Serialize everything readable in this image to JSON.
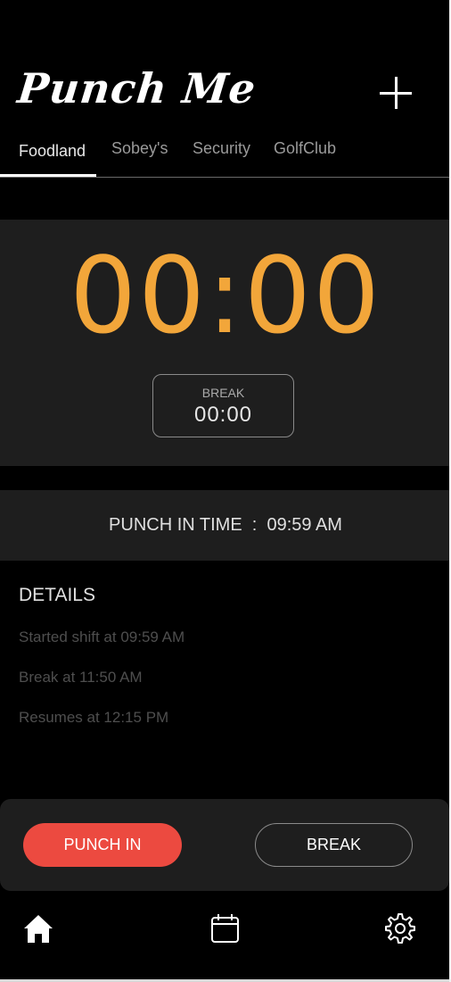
{
  "header": {
    "title": "Punch Me",
    "add_icon": "plus-icon"
  },
  "tabs": [
    {
      "label": "Foodland",
      "active": true
    },
    {
      "label": "Sobey's",
      "active": false
    },
    {
      "label": "Security",
      "active": false
    },
    {
      "label": "GolfClub",
      "active": false
    }
  ],
  "timer": {
    "main": "00:00",
    "break_label": "BREAK",
    "break_value": "00:00"
  },
  "punch_in": {
    "text": "PUNCH IN TIME  :  09:59 AM"
  },
  "details": {
    "title": "DETAILS",
    "lines": [
      "Started shift at 09:59 AM",
      "Break at 11:50 AM",
      "Resumes at 12:15 PM"
    ]
  },
  "actions": {
    "punch_in_label": "PUNCH IN",
    "break_label": "BREAK"
  },
  "bottom_nav": {
    "home_icon": "home-icon",
    "calendar_icon": "calendar-icon",
    "settings_icon": "gear-icon"
  },
  "colors": {
    "timer": "#f2a63a",
    "punch_in_button": "#ec4a40",
    "panel": "#1e1e1e",
    "background": "#000000"
  }
}
